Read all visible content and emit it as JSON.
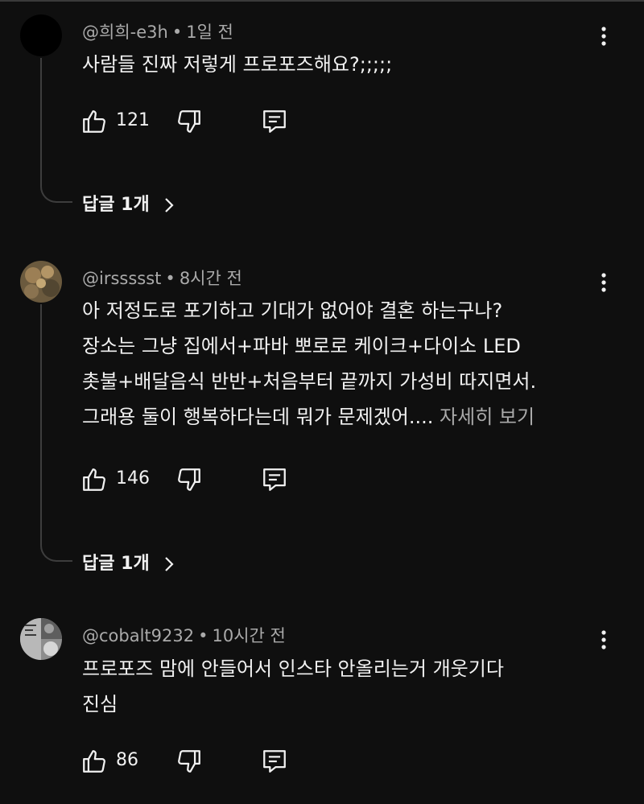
{
  "comments": [
    {
      "author": "@희희-e3h",
      "time": "1일 전",
      "lines": [
        "사람들 진짜 저렇게 프로포즈해요?;;;;;"
      ],
      "more": "",
      "likes": "121",
      "replies": "답글 1개"
    },
    {
      "author": "@irssssst",
      "time": "8시간 전",
      "lines": [
        "아 저정도로 포기하고 기대가 없어야 결혼 하는구나?",
        "장소는 그냥 집에서+파바 뽀로로 케이크+다이소 LED",
        "촛불+배달음식 반반+처음부터 끝까지 가성비 따지면서.",
        "그래용 둘이 행복하다는데 뭐가 문제겠어...."
      ],
      "more": "자세히 보기",
      "likes": "146",
      "replies": "답글 1개"
    },
    {
      "author": "@cobalt9232",
      "time": "10시간 전",
      "lines": [
        "프로포즈 맘에 안들어서 인스타 안올리는거 개웃기다",
        "진심"
      ],
      "more": "",
      "likes": "86",
      "replies": ""
    }
  ],
  "separator": "•",
  "icons": {
    "like": "thumbs-up-icon",
    "dislike": "thumbs-down-icon",
    "reply": "reply-icon",
    "menu": "more-vert-icon",
    "chevron": "chevron-right-icon"
  },
  "colors": {
    "background": "#0f0f0f",
    "text": "#f1f1f1",
    "secondary": "#aaaaaa",
    "thread": "#3d3d3d"
  }
}
